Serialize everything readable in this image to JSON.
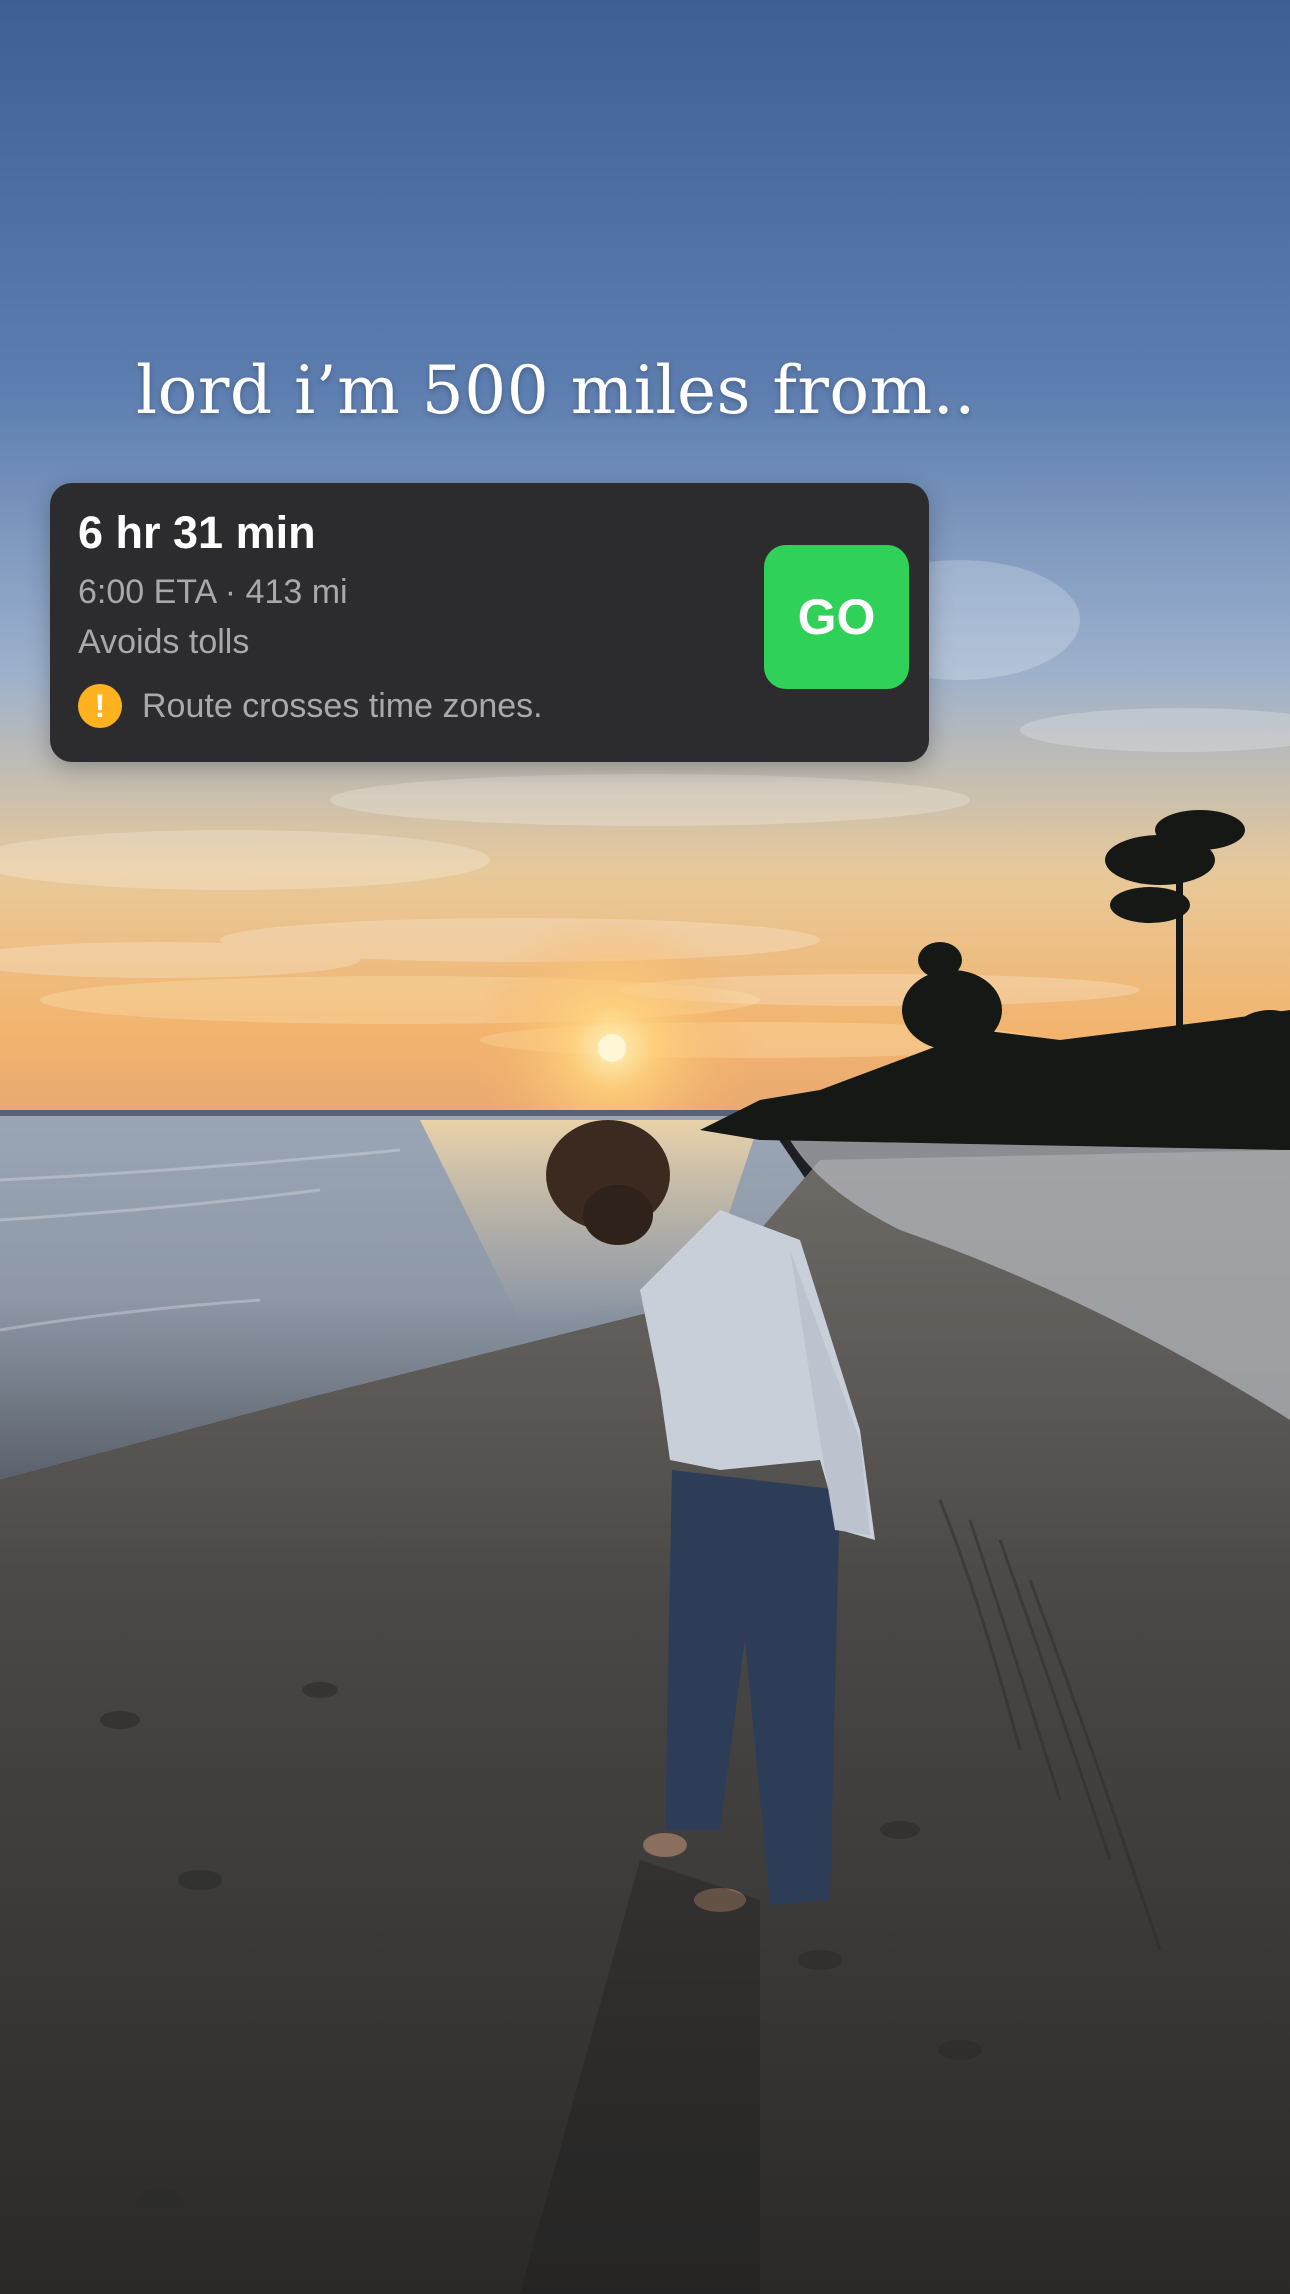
{
  "caption": "lord i’m 500 miles from..",
  "route_card": {
    "duration": "6 hr 31 min",
    "meta": "6:00 ETA · 413 mi",
    "avoids": "Avoids tolls",
    "warning_icon": "!",
    "warning_text": "Route crosses time zones.",
    "go_label": "GO",
    "colors": {
      "card_background": "#2c2c2e",
      "go_button": "#30d158",
      "warning_icon": "#ffb21f"
    }
  },
  "icons": {
    "warning": "exclamation-circle-icon"
  }
}
